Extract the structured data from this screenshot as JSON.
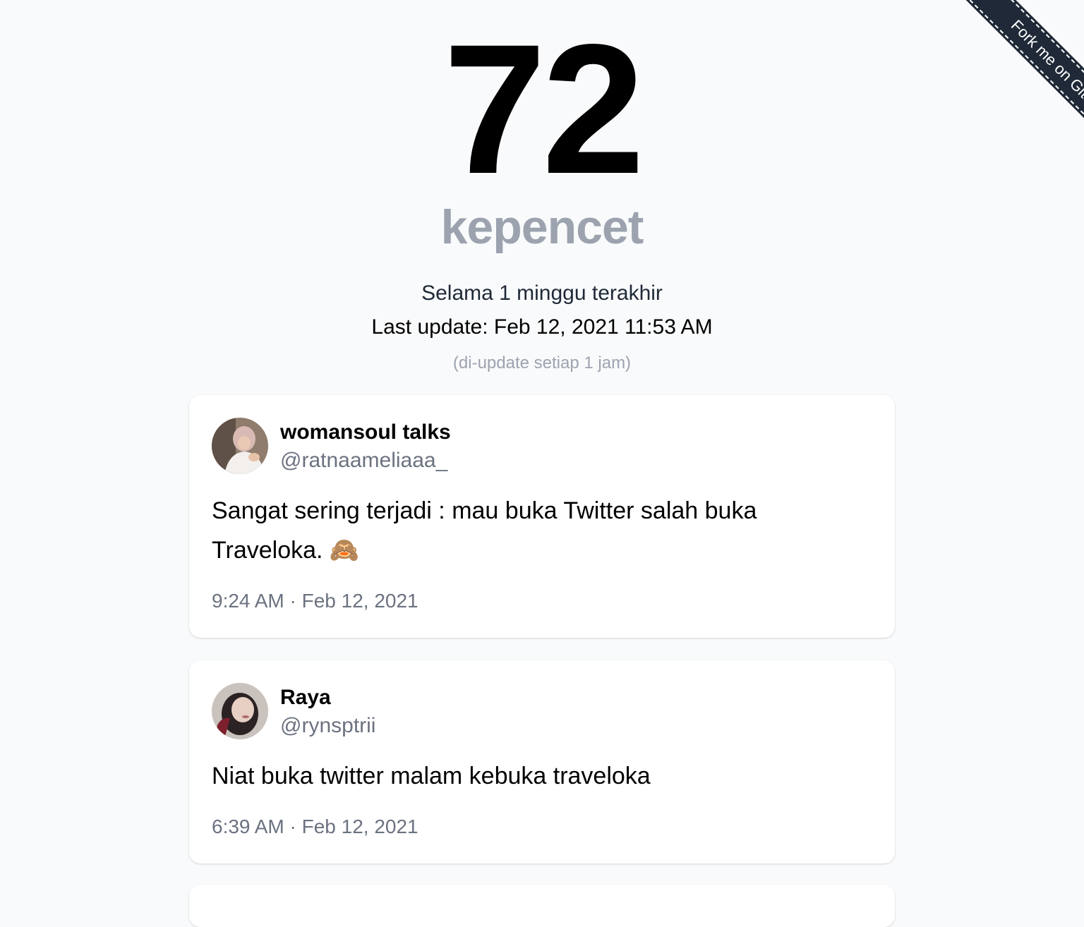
{
  "hero": {
    "count": "72",
    "count_label": "kepencet",
    "period": "Selama 1 minggu terakhir",
    "last_update": "Last update: Feb 12, 2021 11:53 AM",
    "update_frequency": "(di-update setiap 1 jam)"
  },
  "ribbon": {
    "label": "Fork me on GitHub"
  },
  "tweets": [
    {
      "display_name": "womansoul talks",
      "handle": "@ratnaameliaaa_",
      "text": "Sangat sering terjadi : mau buka Twitter salah buka Traveloka. 🙈",
      "timestamp": "9:24 AM · Feb 12, 2021"
    },
    {
      "display_name": "Raya",
      "handle": "@rynsptrii",
      "text": "Niat buka twitter malam kebuka traveloka",
      "timestamp": "6:39 AM · Feb 12, 2021"
    }
  ],
  "colors": {
    "background": "#f9fafb",
    "count": "#000000",
    "count_label": "#9ca3af",
    "muted_text": "#6b7280",
    "card_background": "#ffffff",
    "ribbon": "#1f2937"
  }
}
